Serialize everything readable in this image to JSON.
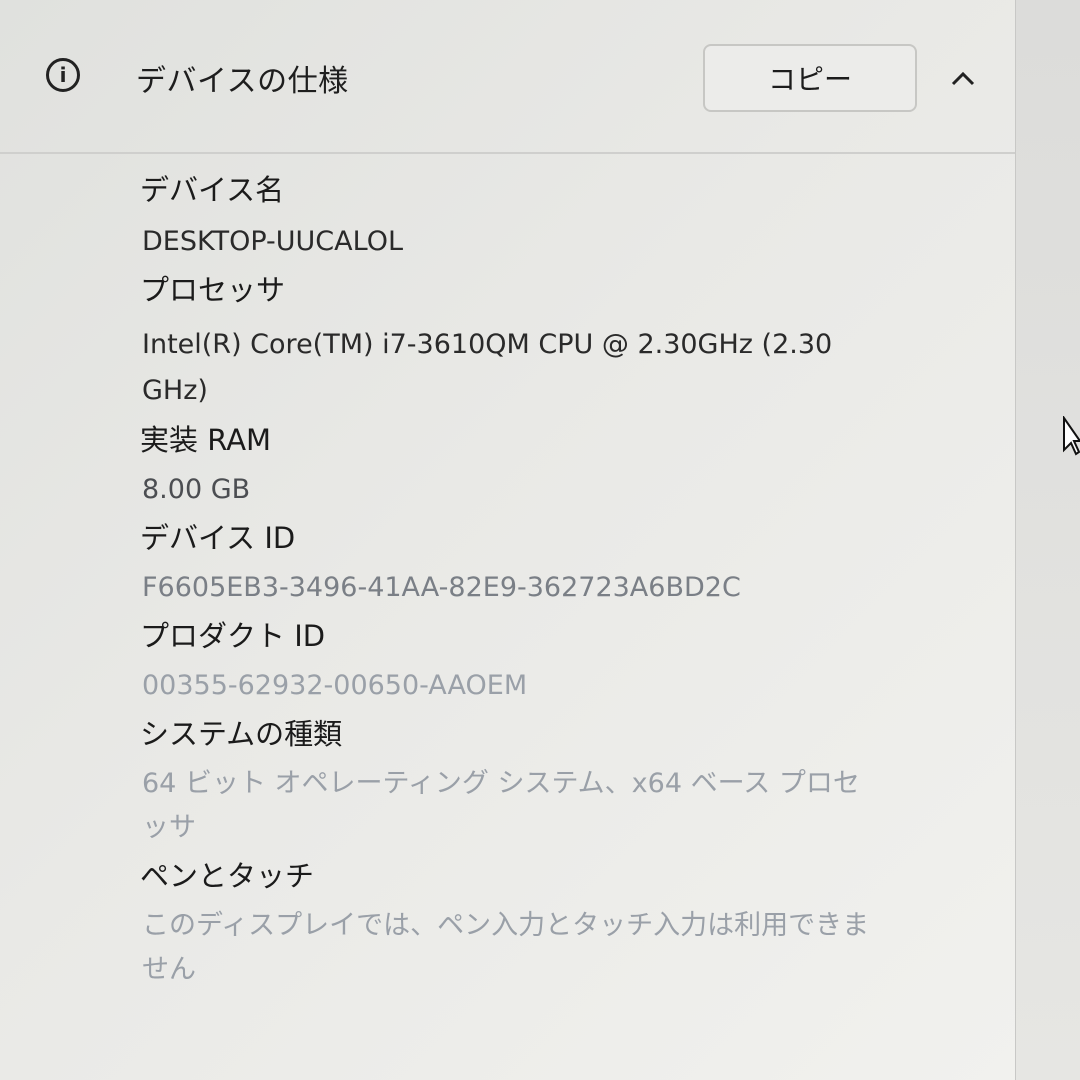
{
  "header": {
    "title": "デバイスの仕様",
    "copy_label": "コピー",
    "info_glyph": "i"
  },
  "specs": [
    {
      "label": "デバイス名",
      "value": "DESKTOP-UUCALOL"
    },
    {
      "label": "プロセッサ",
      "value": "Intel(R) Core(TM) i7-3610QM CPU @ 2.30GHz (2.30 GHz)"
    },
    {
      "label": "実装 RAM",
      "value": "8.00 GB"
    },
    {
      "label": "デバイス ID",
      "value": "F6605EB3-3496-41AA-82E9-362723A6BD2C"
    },
    {
      "label": "プロダクト ID",
      "value": "00355-62932-00650-AAOEM"
    },
    {
      "label": "システムの種類",
      "value": "64 ビット オペレーティング システム、x64 ベース プロセッサ"
    },
    {
      "label": "ペンとタッチ",
      "value": "このディスプレイでは、ペン入力とタッチ入力は利用できません"
    }
  ],
  "colors": {
    "text": "#1b1b1b",
    "panel": "#e9e9e6",
    "border": "#c7c7c4"
  },
  "icons": [
    "info-icon",
    "chevron-up-icon",
    "mouse-cursor-icon"
  ]
}
